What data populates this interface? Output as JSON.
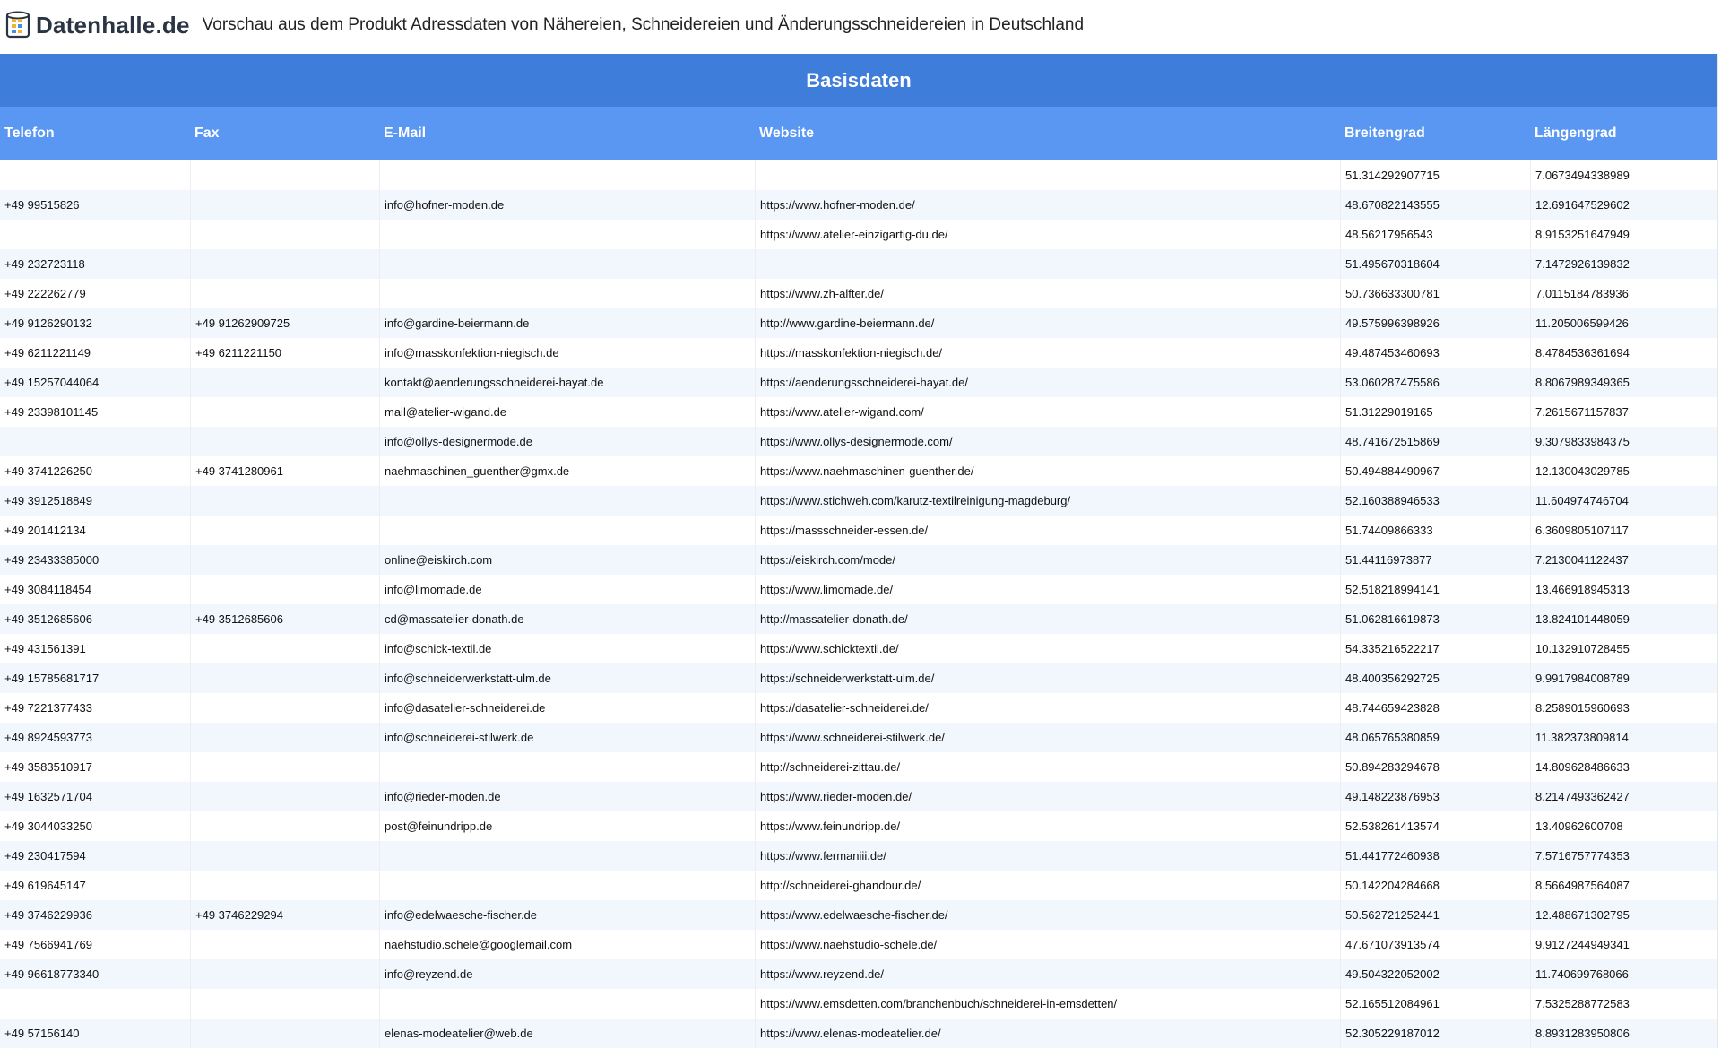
{
  "header": {
    "logo_text": "Datenhalle.de",
    "title": "Vorschau aus dem Produkt Adressdaten von Nähereien, Schneidereien und Änderungsschneidereien in Deutschland"
  },
  "table": {
    "group_title": "Basisdaten",
    "columns": [
      "Telefon",
      "Fax",
      "E-Mail",
      "Website",
      "Breitengrad",
      "Längengrad"
    ],
    "rows": [
      [
        "",
        "",
        "",
        "",
        "51.314292907715",
        "7.0673494338989"
      ],
      [
        "+49 99515826",
        "",
        "info@hofner-moden.de",
        "https://www.hofner-moden.de/",
        "48.670822143555",
        "12.691647529602"
      ],
      [
        "",
        "",
        "",
        "https://www.atelier-einzigartig-du.de/",
        "48.56217956543",
        "8.9153251647949"
      ],
      [
        "+49 232723118",
        "",
        "",
        "",
        "51.495670318604",
        "7.1472926139832"
      ],
      [
        "+49 222262779",
        "",
        "",
        "https://www.zh-alfter.de/",
        "50.736633300781",
        "7.0115184783936"
      ],
      [
        "+49 9126290132",
        "+49 91262909725",
        "info@gardine-beiermann.de",
        "http://www.gardine-beiermann.de/",
        "49.575996398926",
        "11.205006599426"
      ],
      [
        "+49 6211221149",
        "+49 6211221150",
        "info@masskonfektion-niegisch.de",
        "https://masskonfektion-niegisch.de/",
        "49.487453460693",
        "8.4784536361694"
      ],
      [
        "+49 15257044064",
        "",
        "kontakt@aenderungsschneiderei-hayat.de",
        "https://aenderungsschneiderei-hayat.de/",
        "53.060287475586",
        "8.8067989349365"
      ],
      [
        "+49 23398101145",
        "",
        "mail@atelier-wigand.de",
        "https://www.atelier-wigand.com/",
        "51.31229019165",
        "7.2615671157837"
      ],
      [
        "",
        "",
        "info@ollys-designermode.de",
        "https://www.ollys-designermode.com/",
        "48.741672515869",
        "9.3079833984375"
      ],
      [
        "+49 3741226250",
        "+49 3741280961",
        "naehmaschinen_guenther@gmx.de",
        "https://www.naehmaschinen-guenther.de/",
        "50.494884490967",
        "12.130043029785"
      ],
      [
        "+49 3912518849",
        "",
        "",
        "https://www.stichweh.com/karutz-textilreinigung-magdeburg/",
        "52.160388946533",
        "11.604974746704"
      ],
      [
        "+49 201412134",
        "",
        "",
        "https://massschneider-essen.de/",
        "51.74409866333",
        "6.3609805107117"
      ],
      [
        "+49 23433385000",
        "",
        "online@eiskirch.com",
        "https://eiskirch.com/mode/",
        "51.44116973877",
        "7.2130041122437"
      ],
      [
        "+49 3084118454",
        "",
        "info@limomade.de",
        "https://www.limomade.de/",
        "52.518218994141",
        "13.466918945313"
      ],
      [
        "+49 3512685606",
        "+49 3512685606",
        "cd@massatelier-donath.de",
        "http://massatelier-donath.de/",
        "51.062816619873",
        "13.824101448059"
      ],
      [
        "+49 431561391",
        "",
        "info@schick-textil.de",
        "https://www.schicktextil.de/",
        "54.335216522217",
        "10.132910728455"
      ],
      [
        "+49 15785681717",
        "",
        "info@schneiderwerkstatt-ulm.de",
        "https://schneiderwerkstatt-ulm.de/",
        "48.400356292725",
        "9.9917984008789"
      ],
      [
        "+49 7221377433",
        "",
        "info@dasatelier-schneiderei.de",
        "https://dasatelier-schneiderei.de/",
        "48.744659423828",
        "8.2589015960693"
      ],
      [
        "+49 8924593773",
        "",
        "info@schneiderei-stilwerk.de",
        "https://www.schneiderei-stilwerk.de/",
        "48.065765380859",
        "11.382373809814"
      ],
      [
        "+49 3583510917",
        "",
        "",
        "http://schneiderei-zittau.de/",
        "50.894283294678",
        "14.809628486633"
      ],
      [
        "+49 1632571704",
        "",
        "info@rieder-moden.de",
        "https://www.rieder-moden.de/",
        "49.148223876953",
        "8.2147493362427"
      ],
      [
        "+49 3044033250",
        "",
        "post@feinundripp.de",
        "https://www.feinundripp.de/",
        "52.538261413574",
        "13.40962600708"
      ],
      [
        "+49 230417594",
        "",
        "",
        "https://www.fermaniii.de/",
        "51.441772460938",
        "7.5716757774353"
      ],
      [
        "+49 619645147",
        "",
        "",
        "http://schneiderei-ghandour.de/",
        "50.142204284668",
        "8.5664987564087"
      ],
      [
        "+49 3746229936",
        "+49 3746229294",
        "info@edelwaesche-fischer.de",
        "https://www.edelwaesche-fischer.de/",
        "50.562721252441",
        "12.488671302795"
      ],
      [
        "+49 7566941769",
        "",
        "naehstudio.schele@googlemail.com",
        "https://www.naehstudio-schele.de/",
        "47.671073913574",
        "9.9127244949341"
      ],
      [
        "+49 96618773340",
        "",
        "info@reyzend.de",
        "https://www.reyzend.de/",
        "49.504322052002",
        "11.740699768066"
      ],
      [
        "",
        "",
        "",
        "https://www.emsdetten.com/branchenbuch/schneiderei-in-emsdetten/",
        "52.165512084961",
        "7.5325288772583"
      ],
      [
        "+49 57156140",
        "",
        "elenas-modeatelier@web.de",
        "https://www.elenas-modeatelier.de/",
        "52.305229187012",
        "8.8931283950806"
      ]
    ]
  },
  "colors": {
    "group_header_bg": "#3f7ddb",
    "column_header_bg": "#5a97f2",
    "row_alt_bg": "#f2f6fd"
  },
  "icons": {
    "logo": "database-cylinder-icon"
  }
}
